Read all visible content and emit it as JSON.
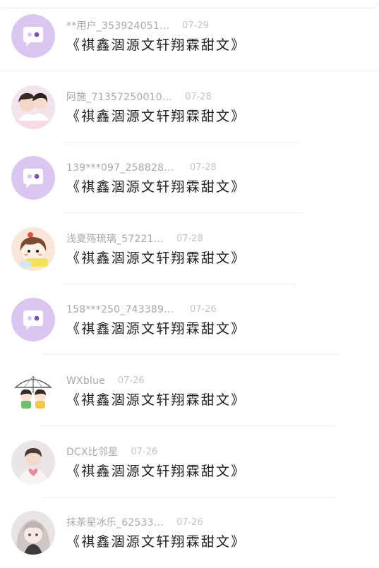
{
  "comments": [
    {
      "username": "**用户_353924051…",
      "time": "07-29",
      "title": "《祺鑫涸源文轩翔霖甜文》",
      "avatar": "default-speech-bubble-avatar"
    },
    {
      "username": "阿施_71357250010…",
      "time": "07-28",
      "title": "《祺鑫涸源文轩翔霖甜文》",
      "avatar": "two-boys-photo-avatar"
    },
    {
      "username": "139***097_2588285…",
      "time": "07-28",
      "title": "《祺鑫涸源文轩翔霖甜文》",
      "avatar": "default-speech-bubble-avatar"
    },
    {
      "username": "浅夏殇琉璃_57221…",
      "time": "07-28",
      "title": "《祺鑫涸源文轩翔霖甜文》",
      "avatar": "cartoon-girl-avatar"
    },
    {
      "username": "158***250_7433897…",
      "time": "07-26",
      "title": "《祺鑫涸源文轩翔霖甜文》",
      "avatar": "default-speech-bubble-avatar"
    },
    {
      "username": "WXblue",
      "time": "07-26",
      "title": "《祺鑫涸源文轩翔霖甜文》",
      "avatar": "cartoon-umbrella-avatar"
    },
    {
      "username": "DCX比邻星",
      "time": "07-26",
      "title": "《祺鑫涸源文轩翔霖甜文》",
      "avatar": "boy-heart-photo-avatar"
    },
    {
      "username": "抹茶星冰乐_62533…",
      "time": "07-26",
      "title": "《祺鑫涸源文轩翔霖甜文》",
      "avatar": "anime-girl-avatar"
    }
  ],
  "colors": {
    "default_avatar_bg": "#d9c7f2",
    "username_gray": "#a9a9a9",
    "time_gray": "#c4c4c4",
    "title_text": "#1e1e1e"
  }
}
